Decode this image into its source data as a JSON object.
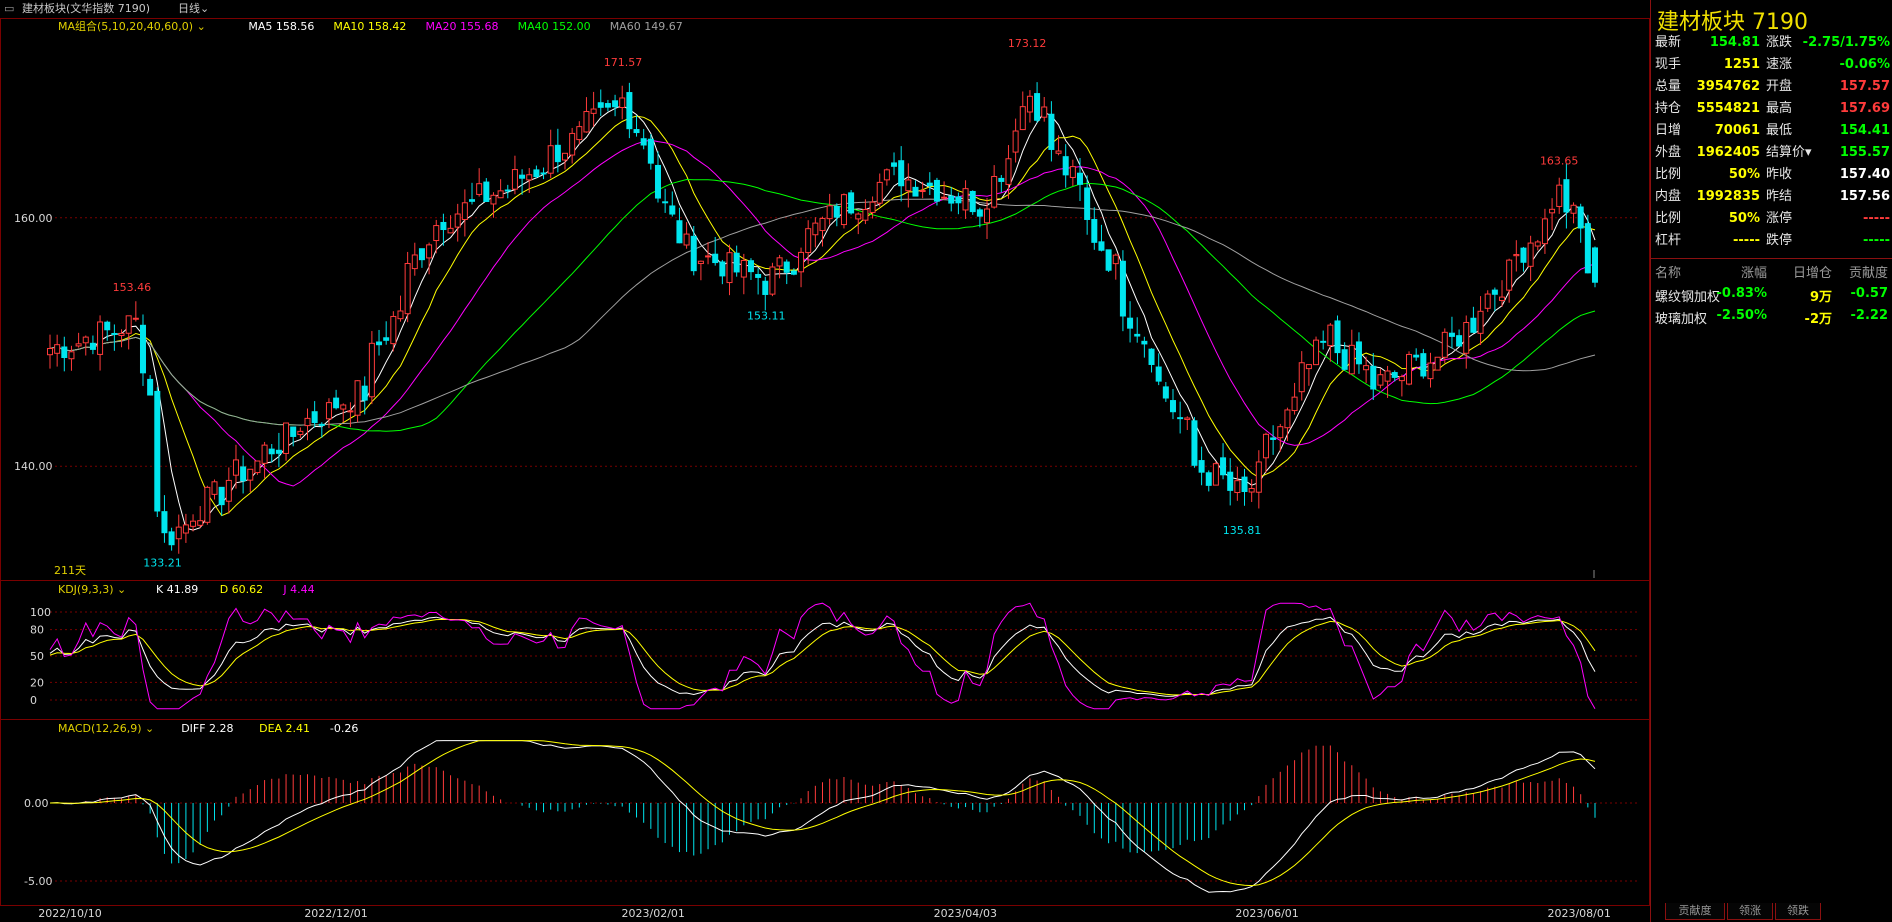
{
  "window": {
    "title": "建材板块(文华指数 7190)",
    "period": "日线"
  },
  "colors": {
    "up": "#ff3b3b",
    "down": "#00e5ee",
    "ma5": "#ffffff",
    "ma10": "#ffff00",
    "ma20": "#ff00ff",
    "ma40": "#00ff00",
    "ma60": "#a0a0a0",
    "grid": "#7a0000",
    "price_label": "#d8d8d8"
  },
  "main_chart": {
    "legend": [
      {
        "text": "MA组合(5,10,20,40,60,0)",
        "color": "#e0d000"
      },
      {
        "text": "MA5 158.56",
        "color": "#ffffff"
      },
      {
        "text": "MA10 158.42",
        "color": "#ffff00"
      },
      {
        "text": "MA20 155.68",
        "color": "#ff00ff"
      },
      {
        "text": "MA40 152.00",
        "color": "#00ff00"
      },
      {
        "text": "MA60 149.67",
        "color": "#a0a0a0"
      }
    ],
    "y_ticks": [
      "160.00",
      "140.00"
    ],
    "days_label": "211天",
    "high_low_labels": [
      {
        "text": "153.46",
        "value": 153.46,
        "date": "2022/10/26",
        "kind": "high"
      },
      {
        "text": "133.21",
        "value": 133.21,
        "date": "2022/11/01",
        "kind": "low"
      },
      {
        "text": "171.57",
        "value": 171.57,
        "date": "2023/01/30",
        "kind": "high"
      },
      {
        "text": "153.11",
        "value": 153.11,
        "date": "2023/02/27",
        "kind": "low"
      },
      {
        "text": "173.12",
        "value": 173.12,
        "date": "2023/04/19",
        "kind": "high"
      },
      {
        "text": "135.81",
        "value": 135.81,
        "date": "2023/05/31",
        "kind": "low"
      },
      {
        "text": "163.65",
        "value": 163.65,
        "date": "2023/08/01",
        "kind": "high"
      }
    ]
  },
  "chart_data": {
    "type": "candlestick",
    "x_range": [
      "2022/10/10",
      "2023/08/08"
    ],
    "y_range": [
      131,
      176
    ],
    "anchors": [
      {
        "date": "2022/10/10",
        "close": 149.5
      },
      {
        "date": "2022/10/26",
        "close": 151.5
      },
      {
        "date": "2022/11/01",
        "close": 134.2
      },
      {
        "date": "2022/11/14",
        "close": 139.0
      },
      {
        "date": "2022/11/28",
        "close": 143.5
      },
      {
        "date": "2022/12/09",
        "close": 146.0
      },
      {
        "date": "2022/12/23",
        "close": 159.5
      },
      {
        "date": "2023/01/09",
        "close": 163.0
      },
      {
        "date": "2023/01/30",
        "close": 169.5
      },
      {
        "date": "2023/02/10",
        "close": 157.5
      },
      {
        "date": "2023/02/27",
        "close": 154.8
      },
      {
        "date": "2023/03/10",
        "close": 160.0
      },
      {
        "date": "2023/03/24",
        "close": 163.5
      },
      {
        "date": "2023/04/10",
        "close": 161.0
      },
      {
        "date": "2023/04/19",
        "close": 170.0
      },
      {
        "date": "2023/05/05",
        "close": 156.0
      },
      {
        "date": "2023/05/22",
        "close": 140.0
      },
      {
        "date": "2023/05/31",
        "close": 137.5
      },
      {
        "date": "2023/06/16",
        "close": 150.5
      },
      {
        "date": "2023/06/26",
        "close": 146.5
      },
      {
        "date": "2023/07/10",
        "close": 149.5
      },
      {
        "date": "2023/07/24",
        "close": 157.0
      },
      {
        "date": "2023/08/01",
        "close": 162.0
      },
      {
        "date": "2023/08/08",
        "close": 154.81
      }
    ],
    "x_tick_labels": [
      "2022/10/10",
      "2022/12/01",
      "2023/02/01",
      "2023/04/03",
      "2023/06/01",
      "2023/08/01"
    ]
  },
  "kdj": {
    "legend": [
      {
        "text": "KDJ(9,3,3)",
        "color": "#e0d000"
      },
      {
        "text": "K 41.89",
        "color": "#ffffff"
      },
      {
        "text": "D 60.62",
        "color": "#ffff00"
      },
      {
        "text": "J 4.44",
        "color": "#ff00ff"
      }
    ],
    "y_ticks": [
      "100",
      "80",
      "50",
      "20",
      "0"
    ],
    "y_tick_values": [
      100,
      80,
      50,
      20,
      0
    ]
  },
  "macd": {
    "legend": [
      {
        "text": "MACD(12,26,9)",
        "color": "#e0d000"
      },
      {
        "text": "DIFF 2.28",
        "color": "#ffffff"
      },
      {
        "text": "DEA 2.41",
        "color": "#ffff00"
      },
      {
        "text": "-0.26",
        "color": "#ffffff"
      }
    ],
    "y_ticks": [
      "0.00",
      "-5.00"
    ],
    "y_tick_values": [
      0,
      -5
    ]
  },
  "quote": {
    "title": "建材板块  7190",
    "rows": [
      [
        {
          "label": "最新",
          "value": "154.81",
          "color": "#00ff00"
        },
        {
          "label": "涨跌",
          "value": "-2.75/1.75%",
          "color": "#00ff00"
        }
      ],
      [
        {
          "label": "现手",
          "value": "1251",
          "color": "#ffff00"
        },
        {
          "label": "速涨",
          "value": "-0.06%",
          "color": "#00ff00"
        }
      ],
      [
        {
          "label": "总量",
          "value": "3954762",
          "color": "#ffff00"
        },
        {
          "label": "开盘",
          "value": "157.57",
          "color": "#ff3b3b"
        }
      ],
      [
        {
          "label": "持仓",
          "value": "5554821",
          "color": "#ffff00"
        },
        {
          "label": "最高",
          "value": "157.69",
          "color": "#ff3b3b"
        }
      ],
      [
        {
          "label": "日增",
          "value": "70061",
          "color": "#ffff00"
        },
        {
          "label": "最低",
          "value": "154.41",
          "color": "#00ff00"
        }
      ],
      [
        {
          "label": "外盘",
          "value": "1962405",
          "color": "#ffff00"
        },
        {
          "label": "结算价▾",
          "value": "155.57",
          "color": "#00ff00"
        }
      ],
      [
        {
          "label": "比例",
          "value": "50%",
          "color": "#ffff00"
        },
        {
          "label": "昨收",
          "value": "157.40",
          "color": "#ffffff"
        }
      ],
      [
        {
          "label": "内盘",
          "value": "1992835",
          "color": "#ffff00"
        },
        {
          "label": "昨结",
          "value": "157.56",
          "color": "#ffffff"
        }
      ],
      [
        {
          "label": "比例",
          "value": "50%",
          "color": "#ffff00"
        },
        {
          "label": "涨停",
          "value": "-----",
          "color": "#ff3b3b"
        }
      ],
      [
        {
          "label": "杠杆",
          "value": "-----",
          "color": "#ffff00"
        },
        {
          "label": "跌停",
          "value": "-----",
          "color": "#00ff00"
        }
      ]
    ],
    "components_header": [
      "名称",
      "涨幅",
      "日增仓",
      "贡献度"
    ],
    "components": [
      {
        "name": "螺纹钢加权",
        "change": "-0.83%",
        "oi": "9万",
        "contrib": "-0.57"
      },
      {
        "name": "玻璃加权",
        "change": "-2.50%",
        "oi": "-2万",
        "contrib": "-2.22"
      }
    ]
  },
  "bottom_tabs": [
    "贡献度",
    "领涨",
    "领跌"
  ]
}
